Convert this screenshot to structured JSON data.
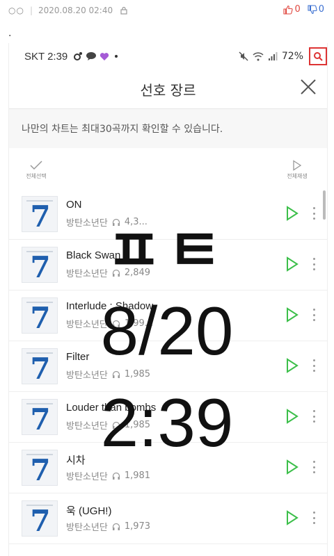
{
  "post": {
    "dots": "○○",
    "separator": "|",
    "date": "2020.08.20 02:40",
    "upvotes": "0",
    "downvotes": "0",
    "dot_text": "."
  },
  "status": {
    "carrier_time": "SKT 2:39",
    "battery": "72%"
  },
  "header": {
    "title": "선호 장르"
  },
  "subbar": {
    "text": "나만의 차트는 최대30곡까지 확인할 수 있습니다."
  },
  "actions": {
    "select_all": "전체선택",
    "play_all": "전체재생"
  },
  "songs": [
    {
      "title": "ON",
      "artist": "방탄소년단",
      "count": "4,3..."
    },
    {
      "title": "Black Swan",
      "artist": "방탄소년단",
      "count": "2,849"
    },
    {
      "title": "Interlude : Shadow",
      "artist": "방탄소년단",
      "count": "1,99..."
    },
    {
      "title": "Filter",
      "artist": "방탄소년단",
      "count": "1,985"
    },
    {
      "title": "Louder than bombs",
      "artist": "방탄소년단",
      "count": "1,985"
    },
    {
      "title": "시차",
      "artist": "방탄소년단",
      "count": "1,981"
    },
    {
      "title": "욱 (UGH!)",
      "artist": "방탄소년단",
      "count": "1,973"
    }
  ],
  "overlay": {
    "line1": "ㅍㅌ",
    "line2": "8/20",
    "line3": "2:39"
  },
  "colors": {
    "play_green": "#3cbf4a",
    "vote_up": "#e0463e",
    "vote_down": "#3b6fd1",
    "search_red": "#d33"
  }
}
